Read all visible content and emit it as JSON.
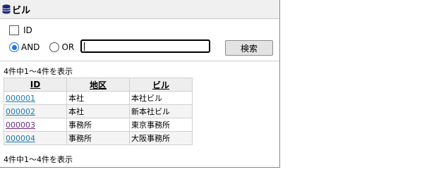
{
  "header": {
    "title": "ビル",
    "icon": "database-icon"
  },
  "filters": {
    "id_checkbox_label": "ID",
    "id_checked": false,
    "mode_and_label": "AND",
    "mode_or_label": "OR",
    "mode_selected": "AND",
    "search_value": "",
    "search_button_label": "検索"
  },
  "results": {
    "count_text": "4件中1～4件を表示",
    "columns": {
      "id": "ID",
      "area": "地区",
      "building": "ビル"
    },
    "rows": [
      {
        "id": "000001",
        "area": "本社",
        "building": "本社ビル",
        "visited": false
      },
      {
        "id": "000002",
        "area": "本社",
        "building": "新本社ビル",
        "visited": false
      },
      {
        "id": "000003",
        "area": "事務所",
        "building": "東京事務所",
        "visited": true
      },
      {
        "id": "000004",
        "area": "事務所",
        "building": "大阪事務所",
        "visited": false
      }
    ]
  },
  "colors": {
    "link": "#1f7ab3",
    "link_visited": "#6b2a86",
    "radio_selected": "#1a73e8"
  }
}
